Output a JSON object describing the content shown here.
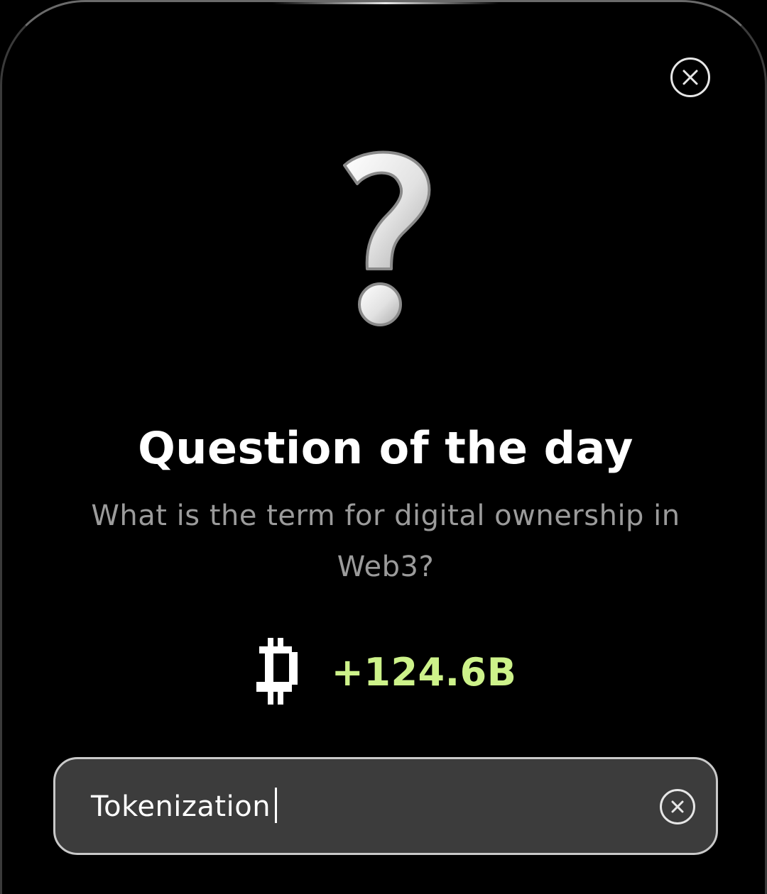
{
  "dialog": {
    "title": "Question of the day",
    "question": "What is the term for digital ownership in Web3?",
    "icon": "question-mark-icon",
    "close_icon": "close-icon"
  },
  "reward": {
    "currency_icon": "pixel-bitcoin-icon",
    "amount": "+124.6B",
    "amount_color": "#cdf28a"
  },
  "answer": {
    "value": "Tokenization",
    "clear_icon": "clear-icon"
  }
}
